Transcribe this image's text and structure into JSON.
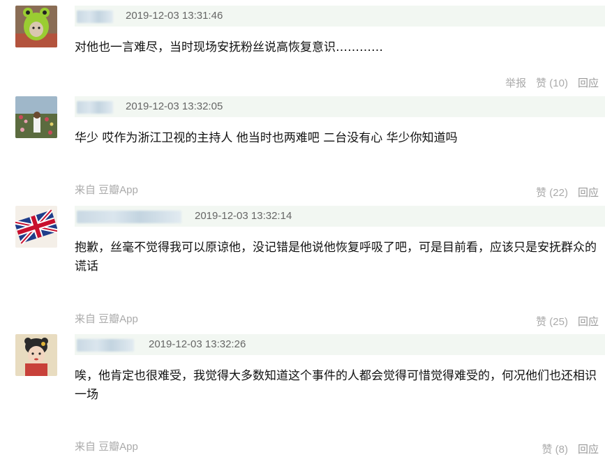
{
  "comments": [
    {
      "timestamp": "2019-12-03 13:31:46",
      "text": "对他也一言难尽，当时现场安抚粉丝说高恢复意识…………",
      "source": "",
      "report": "举报",
      "like": "赞 (10)",
      "reply": "回应",
      "avatar_icon": "green-frog-hat-avatar"
    },
    {
      "timestamp": "2019-12-03 13:32:05",
      "text": "华少 哎作为浙江卫视的主持人 他当时也两难吧 二台没有心 华少你知道吗",
      "source": "来自 豆瓣App",
      "like": "赞 (22)",
      "reply": "回应",
      "avatar_icon": "flower-field-avatar"
    },
    {
      "timestamp": "2019-12-03 13:32:14",
      "text": "抱歉，丝毫不觉得我可以原谅他，没记错是他说他恢复呼吸了吧，可是目前看，应该只是安抚群众的谎话",
      "source": "来自 豆瓣App",
      "like": "赞 (25)",
      "reply": "回应",
      "avatar_icon": "union-jack-avatar"
    },
    {
      "timestamp": "2019-12-03 13:32:26",
      "text": "唉，他肯定也很难受，我觉得大多数知道这个事件的人都会觉得可惜觉得难受的，何况他们也还相识一场",
      "source": "来自 豆瓣App",
      "like": "赞 (8)",
      "reply": "回应",
      "avatar_icon": "illustrated-girl-avatar"
    }
  ],
  "colors": {
    "meta_bar": "#f2f7f2",
    "timestamp": "#666666",
    "muted": "#aaaaaa"
  }
}
